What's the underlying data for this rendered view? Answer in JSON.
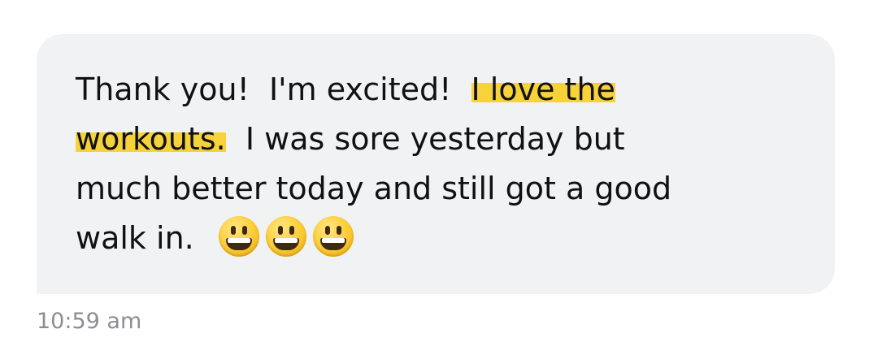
{
  "message": {
    "part1": "Thank you!  I'm excited!  ",
    "highlight1": "I love the",
    "newline1": "\n",
    "highlight2": "workouts.",
    "part2": "  I was sore yesterday but\nmuch better today and still got a good\nwalk in.",
    "emojis": [
      "grinning-face",
      "grinning-face",
      "grinning-face"
    ],
    "highlight_color": "#F7CE21",
    "bubble_color": "#F1F2F4"
  },
  "timestamp": "10:59 am"
}
